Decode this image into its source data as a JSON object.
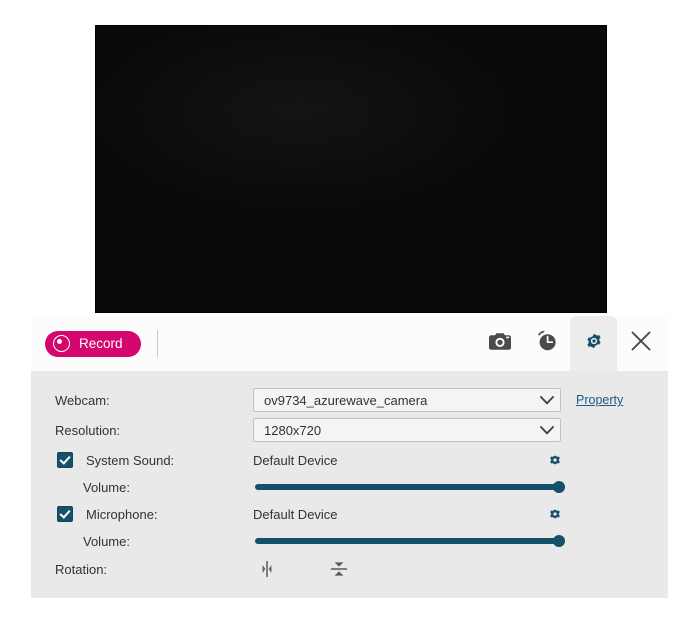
{
  "app": {
    "preview_alt": "webcam-live-preview"
  },
  "toolbar": {
    "record_label": "Record",
    "buttons": [
      {
        "name": "snapshot",
        "icon": "camera-icon",
        "active": false
      },
      {
        "name": "schedule",
        "icon": "clock-icon",
        "active": false
      },
      {
        "name": "settings",
        "icon": "gear-icon",
        "active": true
      },
      {
        "name": "close",
        "icon": "close-icon",
        "active": false
      }
    ]
  },
  "settings": {
    "webcam": {
      "label": "Webcam:",
      "value": "ov9734_azurewave_camera",
      "property_link": "Property"
    },
    "resolution": {
      "label": "Resolution:",
      "value": "1280x720"
    },
    "system_sound": {
      "label": "System Sound:",
      "checked": true,
      "device": "Default Device",
      "volume_label": "Volume:",
      "volume": 100
    },
    "microphone": {
      "label": "Microphone:",
      "checked": true,
      "device": "Default Device",
      "volume_label": "Volume:",
      "volume": 100
    },
    "rotation": {
      "label": "Rotation:",
      "flip_horizontal_icon": "flip-horizontal-icon",
      "flip_vertical_icon": "flip-vertical-icon"
    }
  },
  "colors": {
    "record_pink": "#d3076e",
    "accent_teal": "#145069",
    "panel_bg": "#e9e9e9",
    "toolbar_bg": "#fcfcfc",
    "link": "#1c5a82"
  }
}
